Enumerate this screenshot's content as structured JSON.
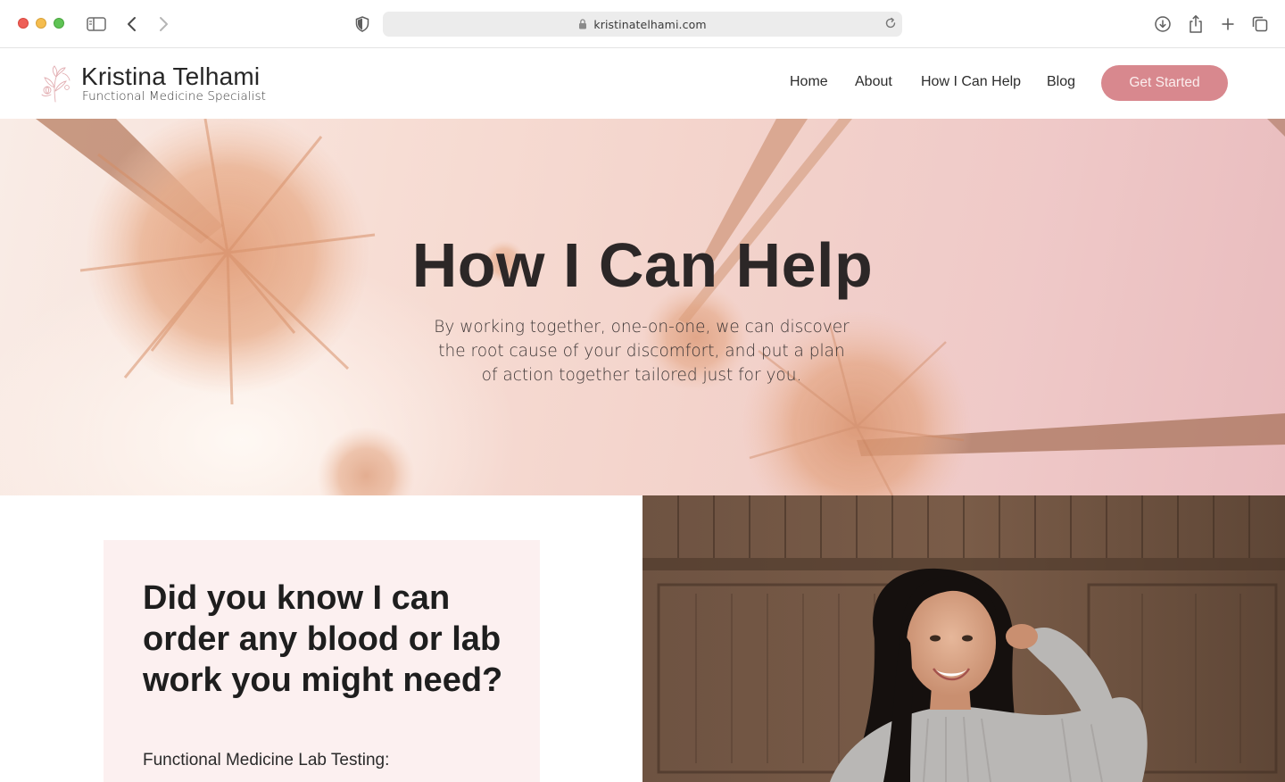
{
  "browser": {
    "url": "kristinatelhami.com"
  },
  "site": {
    "brand_name": "Kristina Telhami",
    "tagline": "Functional Medicine Specialist",
    "nav": [
      {
        "label": "Home"
      },
      {
        "label": "About"
      },
      {
        "label": "How I Can Help"
      },
      {
        "label": "Blog"
      }
    ],
    "cta_label": "Get Started"
  },
  "hero": {
    "title": "How I Can Help",
    "subtitle": "By working together, one-on-one, we can discover the root cause of your discomfort, and put a plan of action together tailored just for you."
  },
  "card": {
    "title": "Did you know I can order any blood or lab work you might need?",
    "subtitle": "Functional Medicine Lab Testing:"
  },
  "colors": {
    "cta": "#d8888e",
    "card_bg": "#fcf0f0",
    "hero_tint": "#f3d3cb"
  }
}
